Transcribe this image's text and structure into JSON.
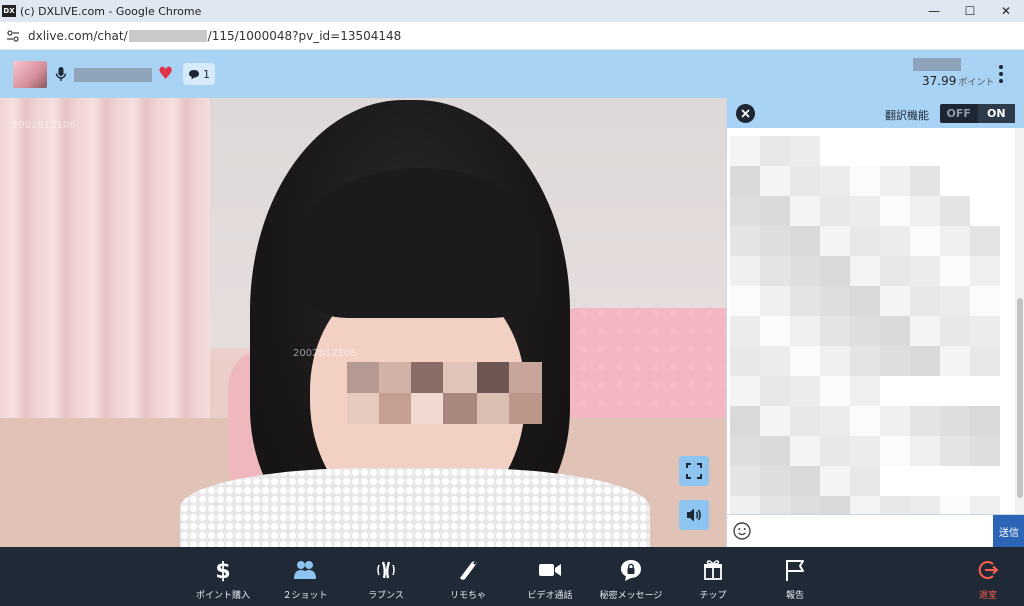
{
  "window": {
    "favicon": "DX",
    "title": "(c) DXLIVE.com - Google Chrome",
    "controls": {
      "minimize": "—",
      "maximize": "☐",
      "close": "✕"
    }
  },
  "address": {
    "url_prefix": "dxlive.com/chat/",
    "url_suffix": "/115/1000048?pv_id=13504148"
  },
  "header": {
    "viewer_count": "1",
    "points_value": "37.99",
    "points_unit": "ポイント"
  },
  "video": {
    "watermark_top": "2002812106",
    "watermark_mid": "2002812106",
    "fullscreen_icon": "expand-icon",
    "volume_icon": "speaker-icon"
  },
  "chat": {
    "translate_label": "翻訳機能",
    "toggle_off": "OFF",
    "toggle_on": "ON",
    "send_label": "送信",
    "input_value": "",
    "input_placeholder": ""
  },
  "toolbar": {
    "items": [
      {
        "label": "ポイント購入",
        "icon": "dollar-icon"
      },
      {
        "label": "２ショット",
        "icon": "two-users-icon"
      },
      {
        "label": "ラブンス",
        "icon": "vibration-icon"
      },
      {
        "label": "リモちゃ",
        "icon": "remote-toy-icon"
      },
      {
        "label": "ビデオ通話",
        "icon": "video-camera-icon"
      },
      {
        "label": "秘密メッセージ",
        "icon": "lock-message-icon"
      },
      {
        "label": "チップ",
        "icon": "gift-icon"
      },
      {
        "label": "報告",
        "icon": "flag-icon"
      },
      {
        "label": "退室",
        "icon": "exit-icon"
      }
    ]
  },
  "colors": {
    "appbar": "#a9d3f5",
    "toolbar": "#1f2a36",
    "send": "#2c64b6",
    "heart": "#e2334b",
    "exit": "#ff5f50"
  }
}
